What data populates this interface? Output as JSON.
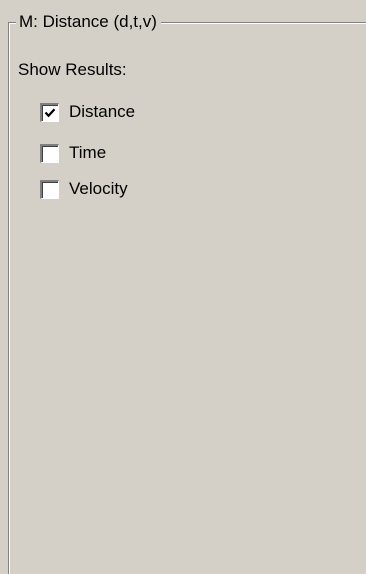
{
  "group": {
    "title": "M: Distance (d,t,v)",
    "show_results_label": "Show Results:"
  },
  "checkboxes": [
    {
      "label": "Distance",
      "checked": true
    },
    {
      "label": "Time",
      "checked": false
    },
    {
      "label": "Velocity",
      "checked": false
    }
  ]
}
